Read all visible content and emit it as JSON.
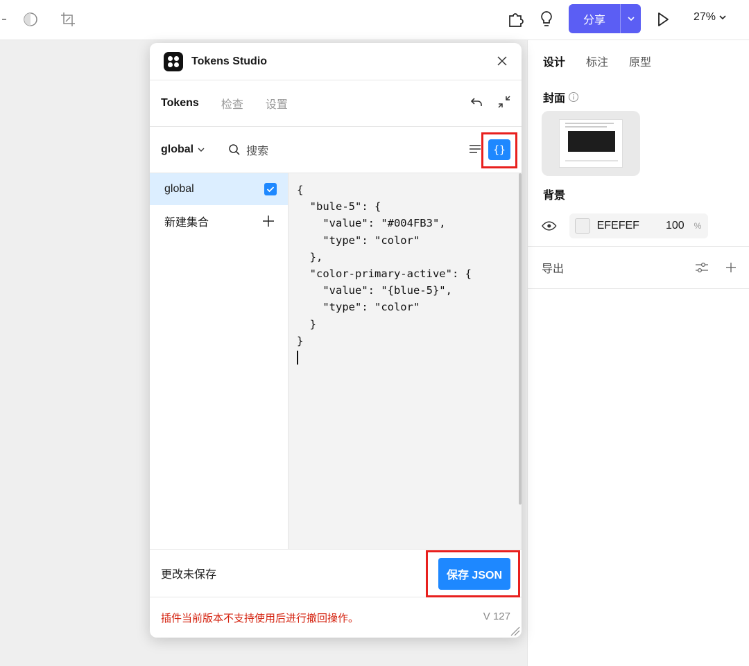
{
  "toolbar": {
    "share_label": "分享",
    "zoom": "27%",
    "icons": [
      "contrast-icon",
      "crop-icon",
      "plugin-icon",
      "lightbulb-icon",
      "play-icon"
    ]
  },
  "right_panel": {
    "tabs": [
      {
        "label": "设计",
        "active": true
      },
      {
        "label": "标注",
        "active": false
      },
      {
        "label": "原型",
        "active": false
      }
    ],
    "cover_label": "封面",
    "background_label": "背景",
    "bg_color": "EFEFEF",
    "bg_opacity": "100",
    "bg_opacity_unit": "%",
    "export_label": "导出"
  },
  "plugin": {
    "title": "Tokens Studio",
    "tabs": [
      {
        "label": "Tokens",
        "active": true
      },
      {
        "label": "检查",
        "active": false
      },
      {
        "label": "设置",
        "active": false
      }
    ],
    "set_selector": "global",
    "search_placeholder": "搜索",
    "json_button": "{}",
    "sets": [
      {
        "label": "global",
        "checked": true
      },
      {
        "label": "新建集合"
      }
    ],
    "code": "{\n  \"bule-5\": {\n    \"value\": \"#004FB3\",\n    \"type\": \"color\"\n  },\n  \"color-primary-active\": {\n    \"value\": \"{blue-5}\",\n    \"type\": \"color\"\n  }\n}",
    "unsaved_label": "更改未保存",
    "save_label": "保存 JSON",
    "warning": "插件当前版本不支持使用后进行撤回操作。",
    "version": "V 127"
  },
  "colors": {
    "share_button": "#5b5ef4",
    "primary": "#1e88ff",
    "highlight": "#e8201e",
    "warning_text": "#d4210e"
  }
}
